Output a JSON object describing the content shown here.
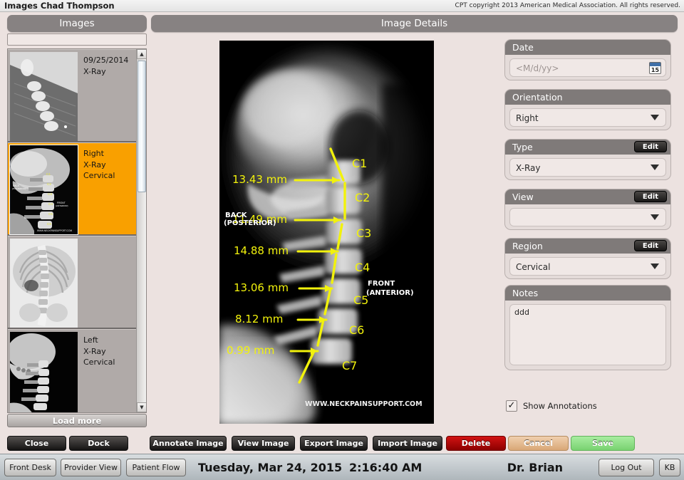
{
  "titlebar": {
    "app_title": "Images Chad Thompson",
    "cpt_notice": "CPT copyright 2013 American Medical Association. All rights reserved."
  },
  "panels": {
    "images_header": "Images",
    "details_header": "Image Details"
  },
  "sidebar": {
    "search_value": "",
    "load_more_label": "Load more",
    "thumbnails": [
      {
        "line1": "09/25/2014",
        "line2": "X-Ray",
        "line3": "",
        "selected": false,
        "kind": "flexion"
      },
      {
        "line1": "Right",
        "line2": "X-Ray",
        "line3": "Cervical",
        "selected": true,
        "kind": "cervical-lateral"
      },
      {
        "line1": "",
        "line2": "",
        "line3": "",
        "selected": false,
        "kind": "thoracic-ap"
      },
      {
        "line1": "Left",
        "line2": "X-Ray",
        "line3": "Cervical",
        "selected": false,
        "kind": "cervical-lateral-dark"
      }
    ]
  },
  "form": {
    "date": {
      "label": "Date",
      "value": "",
      "placeholder": "<M/d/yy>",
      "icon": "calendar-icon",
      "day": "15"
    },
    "orientation": {
      "label": "Orientation",
      "value": "Right"
    },
    "type": {
      "label": "Type",
      "value": "X-Ray",
      "edit_label": "Edit"
    },
    "view": {
      "label": "View",
      "value": "",
      "edit_label": "Edit"
    },
    "region": {
      "label": "Region",
      "value": "Cervical",
      "edit_label": "Edit"
    },
    "notes": {
      "label": "Notes",
      "value": "ddd"
    },
    "show_annotations": {
      "label": "Show Annotations",
      "checked": true,
      "check_glyph": "✓"
    }
  },
  "image_annotations": {
    "back_label_line1": "BACK",
    "back_label_line2": "(POSTERIOR)",
    "front_label_line1": "FRONT",
    "front_label_line2": "(ANTERIOR)",
    "watermark": "WWW.NECKPAINSUPPORT.COM",
    "vertebrae": [
      "C1",
      "C2",
      "C3",
      "C4",
      "C5",
      "C6",
      "C7"
    ],
    "measurements": [
      {
        "label": "13.43 mm",
        "vertebra": "C1-C2"
      },
      {
        "label": "11.49 mm",
        "vertebra": "C2-C3"
      },
      {
        "label": "14.88 mm",
        "vertebra": "C3-C4"
      },
      {
        "label": "13.06 mm",
        "vertebra": "C4-C5"
      },
      {
        "label": "8.12 mm",
        "vertebra": "C5-C6"
      },
      {
        "label": "0.99 mm",
        "vertebra": "C6-C7"
      }
    ],
    "annotation_color": "#f2f20c"
  },
  "actions": {
    "close": "Close",
    "dock": "Dock",
    "annotate_image": "Annotate Image",
    "view_image": "View Image",
    "export_image": "Export Image",
    "import_image": "Import Image",
    "delete": "Delete",
    "cancel": "Cancel",
    "save": "Save"
  },
  "statusbar": {
    "front_desk": "Front Desk",
    "provider_view": "Provider View",
    "patient_flow": "Patient Flow",
    "date": "Tuesday, Mar 24, 2015",
    "time": "2:16:40 AM",
    "doctor": "Dr. Brian",
    "log_out": "Log Out",
    "kb": "KB"
  },
  "colors": {
    "accent_selected": "#f9a000",
    "panel_header": "#878282",
    "background": "#ece2e0",
    "delete": "#d21212",
    "cancel": "#d9a877",
    "save": "#79d271"
  }
}
